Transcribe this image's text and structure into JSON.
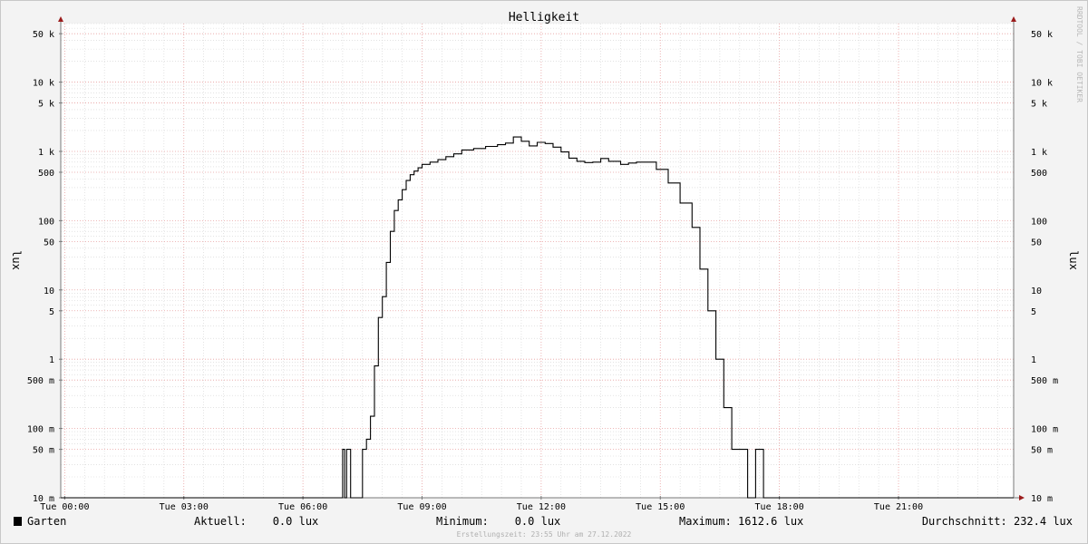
{
  "chart_data": {
    "type": "line",
    "title": "Helligkeit",
    "ylabel": "lux",
    "yscale": "log",
    "ylim": [
      0.01,
      70000
    ],
    "y_ticks": [
      {
        "value": 0.01,
        "label": "10 m"
      },
      {
        "value": 0.05,
        "label": "50 m"
      },
      {
        "value": 0.1,
        "label": "100 m"
      },
      {
        "value": 0.5,
        "label": "500 m"
      },
      {
        "value": 1,
        "label": "1"
      },
      {
        "value": 5,
        "label": "5"
      },
      {
        "value": 10,
        "label": "10"
      },
      {
        "value": 50,
        "label": "50"
      },
      {
        "value": 100,
        "label": "100"
      },
      {
        "value": 500,
        "label": "500"
      },
      {
        "value": 1000,
        "label": "1 k"
      },
      {
        "value": 5000,
        "label": "5 k"
      },
      {
        "value": 10000,
        "label": "10 k"
      },
      {
        "value": 50000,
        "label": "50 k"
      }
    ],
    "xlim": [
      -0.1,
      23.9
    ],
    "x_ticks": [
      {
        "value": 0,
        "label": "Tue 00:00"
      },
      {
        "value": 3,
        "label": "Tue 03:00"
      },
      {
        "value": 6,
        "label": "Tue 06:00"
      },
      {
        "value": 9,
        "label": "Tue 09:00"
      },
      {
        "value": 12,
        "label": "Tue 12:00"
      },
      {
        "value": 15,
        "label": "Tue 15:00"
      },
      {
        "value": 18,
        "label": "Tue 18:00"
      },
      {
        "value": 21,
        "label": "Tue 21:00"
      }
    ],
    "grid": true,
    "series": [
      {
        "name": "Garten",
        "color": "#000000",
        "x": [
          -0.1,
          7.0,
          7.05,
          7.1,
          7.15,
          7.2,
          7.3,
          7.4,
          7.5,
          7.6,
          7.7,
          7.8,
          7.9,
          8.0,
          8.1,
          8.2,
          8.3,
          8.4,
          8.5,
          8.6,
          8.7,
          8.8,
          8.9,
          9.0,
          9.2,
          9.4,
          9.6,
          9.8,
          10.0,
          10.3,
          10.6,
          10.9,
          11.1,
          11.3,
          11.5,
          11.7,
          11.9,
          12.1,
          12.3,
          12.5,
          12.7,
          12.9,
          13.1,
          13.3,
          13.5,
          13.7,
          14.0,
          14.2,
          14.4,
          14.6,
          14.9,
          15.2,
          15.5,
          15.8,
          16.0,
          16.2,
          16.4,
          16.6,
          16.8,
          17.0,
          17.2,
          17.4,
          17.6,
          17.75,
          17.8,
          17.9,
          17.95,
          18.0,
          23.9
        ],
        "y": [
          0.01,
          0.05,
          0.01,
          0.05,
          0.05,
          0.01,
          0.01,
          0.01,
          0.05,
          0.07,
          0.15,
          0.8,
          4,
          8,
          25,
          70,
          140,
          200,
          280,
          380,
          460,
          520,
          580,
          650,
          700,
          760,
          840,
          920,
          1050,
          1100,
          1180,
          1250,
          1320,
          1612.6,
          1400,
          1200,
          1350,
          1300,
          1150,
          980,
          800,
          720,
          690,
          700,
          790,
          720,
          650,
          680,
          700,
          700,
          550,
          350,
          180,
          80,
          20,
          5,
          1,
          0.2,
          0.05,
          0.05,
          0.01,
          0.05,
          0.01,
          0.01,
          0.01,
          0.01,
          0.01,
          0.01,
          0.01
        ]
      }
    ],
    "legend": {
      "position": "bottom",
      "name": "Garten",
      "aktuell": "Aktuell:    0.0 lux",
      "minimum": "Minimum:    0.0 lux",
      "maximum": "Maximum: 1612.6 lux",
      "durchschnitt": "Durchschnitt: 232.4 lux"
    },
    "watermark": "RRDTOOL / TOBI OETIKER",
    "footer": "Erstellungszeit: 23:55 Uhr am 27.12.2022"
  }
}
